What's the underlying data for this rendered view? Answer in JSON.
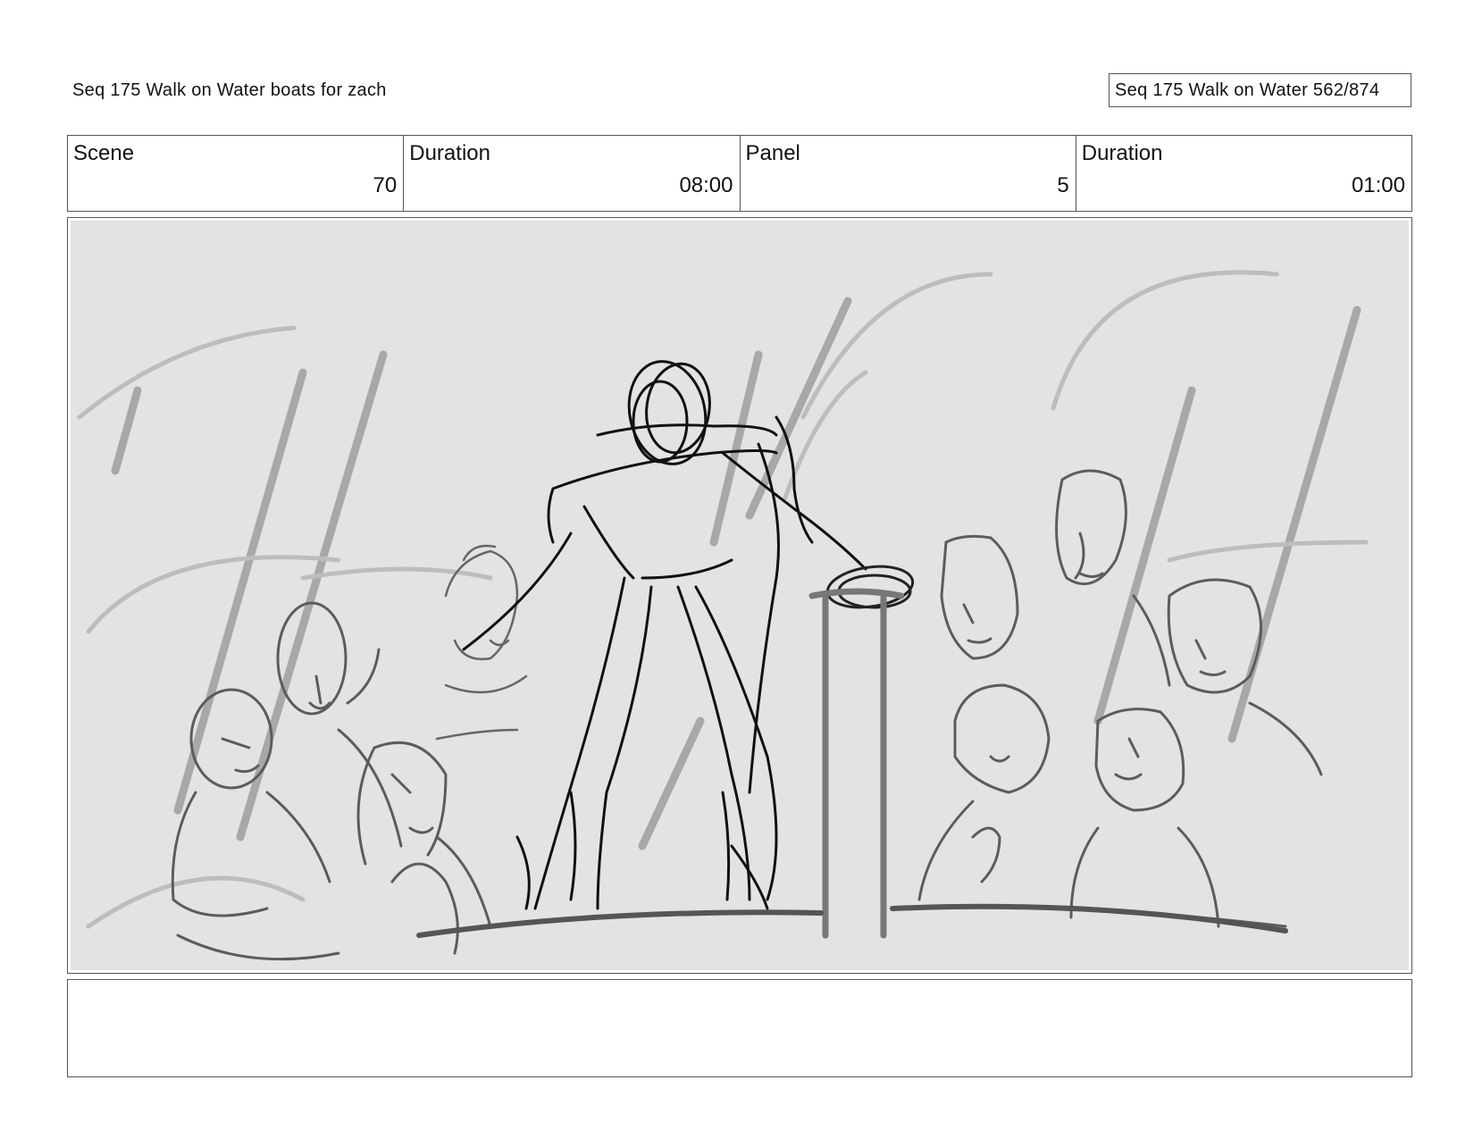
{
  "header": {
    "title": "Seq 175 Walk on Water  boats for zach",
    "page_label": "Seq 175 Walk on Water 562/874"
  },
  "info": [
    {
      "label": "Scene",
      "value": "70"
    },
    {
      "label": "Duration",
      "value": "08:00"
    },
    {
      "label": "Panel",
      "value": "5"
    },
    {
      "label": "Duration",
      "value": "01:00"
    }
  ],
  "notes": {
    "text": ""
  }
}
